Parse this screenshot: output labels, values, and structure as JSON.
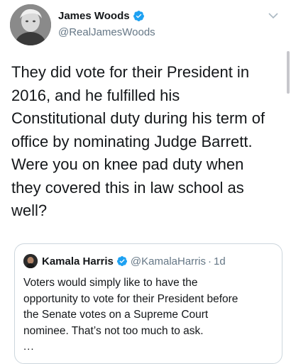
{
  "tweet": {
    "author": {
      "name": "James Woods",
      "handle": "@RealJamesWoods",
      "verified": true
    },
    "text": "They did vote for their President in\n2016, and he fulfilled his\nConstitutional duty during his term of\noffice by nominating Judge Barrett.\nWere you on knee pad duty when\nthey covered this in law school as\nwell?",
    "menu_icon": "chevron-down-icon"
  },
  "quoted_tweet": {
    "author": {
      "name": "Kamala Harris",
      "handle": "@KamalaHarris",
      "separator": "·",
      "time": "1d",
      "verified": true
    },
    "text": "Voters would simply like to have the\nopportunity to vote for their President before\nthe Senate votes on a Supreme Court\nnominee. That’s not too much to ask.",
    "more": "..."
  },
  "colors": {
    "verified_blue": "#1da1f2",
    "secondary_text": "#657786",
    "primary_text": "#14171a",
    "border": "#ccd6dd"
  }
}
